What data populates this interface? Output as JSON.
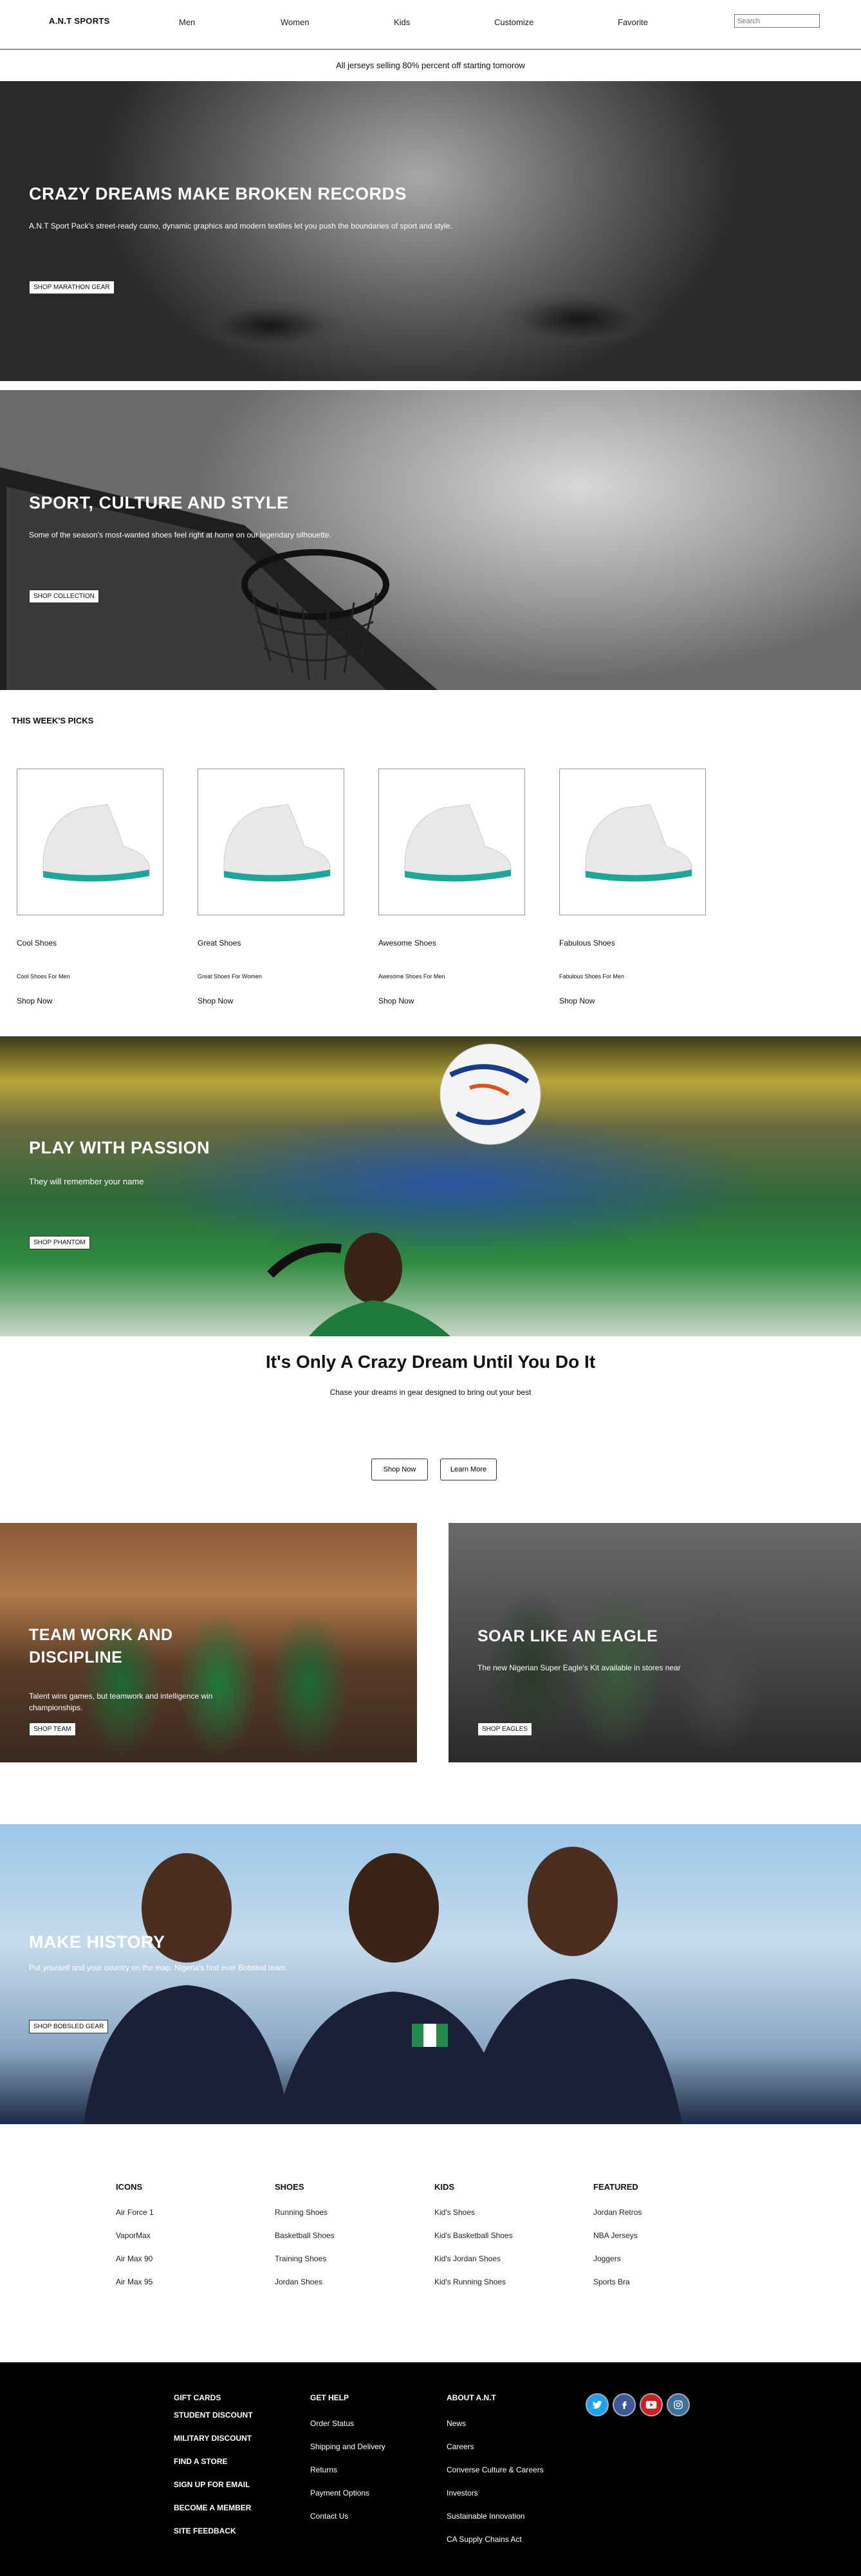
{
  "nav": {
    "brand": "A.N.T SPORTS",
    "links": [
      "Men",
      "Women",
      "Kids",
      "Customize",
      "Favorite"
    ],
    "search_placeholder": "Search"
  },
  "promo": "All jerseys selling 80% percent off starting tomorow",
  "hero1": {
    "title": "CRAZY DREAMS MAKE BROKEN RECORDS",
    "subtitle": "A.N.T Sport Pack's street-ready camo, dynamic graphics and modern textiles let you push the boundaries of sport and style.",
    "button": "SHOP MARATHON GEAR"
  },
  "hero2": {
    "title": "SPORT, CULTURE AND STYLE",
    "subtitle": "Some of the season's most-wanted shoes feel right at home on our legendary silhouette.",
    "button": "SHOP COLLECTION"
  },
  "picks": {
    "title": "THIS WEEK'S PICKS",
    "items": [
      {
        "name": "Cool Shoes",
        "sub": "Cool Shoes For Men",
        "shop": "Shop Now"
      },
      {
        "name": "Great Shoes",
        "sub": "Great Shoes For Women",
        "shop": "Shop Now"
      },
      {
        "name": "Awesome Shoes",
        "sub": "Awesome Shoes For Men",
        "shop": "Shop Now"
      },
      {
        "name": "Fabulous Shoes",
        "sub": "Fabulous Shoes For Men",
        "shop": "Shop Now"
      }
    ]
  },
  "hero3": {
    "title": "PLAY WITH PASSION",
    "subtitle": "They will remember your name",
    "button": "SHOP PHANTOM"
  },
  "dream": {
    "title": "It's Only A Crazy Dream Until You Do It",
    "subtitle": "Chase your dreams in gear designed to bring out your best",
    "shop": "Shop Now",
    "learn": "Learn More"
  },
  "split1": {
    "title_line1": "TEAM WORK AND",
    "title_line2": "DISCIPLINE",
    "subtitle_line1": "Talent wins games, but teamwork and intelligence win",
    "subtitle_line2": "championships.",
    "button": "SHOP TEAM"
  },
  "split2": {
    "title": "SOAR LIKE AN EAGLE",
    "subtitle": "The new Nigerian Super Eagle's Kit available in stores near",
    "button": "SHOP EAGLES"
  },
  "hero4": {
    "title": "MAKE HISTORY",
    "subtitle": "Put yourself and your country on the map. Nigeria's first ever Bobsled team.",
    "button": "SHOP BOBSLED GEAR"
  },
  "link_columns": [
    {
      "head": "ICONS",
      "links": [
        "Air Force 1",
        "VaporMax",
        "Air Max 90",
        "Air Max 95"
      ]
    },
    {
      "head": "SHOES",
      "links": [
        "Running Shoes",
        "Basketball Shoes",
        "Training Shoes",
        "Jordan Shoes"
      ]
    },
    {
      "head": "KIDS",
      "links": [
        "Kid's Shoes",
        "Kid's Basketball Shoes",
        "Kid's Jordan Shoes",
        "Kid's Running Shoes"
      ]
    },
    {
      "head": "FEATURED",
      "links": [
        "Jordan Retros",
        "NBA Jerseys",
        "Joggers",
        "Sports Bra"
      ]
    }
  ],
  "footer": {
    "bold_links": [
      "GIFT CARDS",
      "STUDENT DISCOUNT",
      "MILITARY DISCOUNT",
      "FIND A STORE",
      "SIGN UP FOR EMAIL",
      "BECOME A MEMBER",
      "SITE FEEDBACK"
    ],
    "get_help": {
      "head": "GET HELP",
      "links": [
        "Order Status",
        "Shipping and Delivery",
        "Returns",
        "Payment Options",
        "Contact Us"
      ]
    },
    "about": {
      "head": "ABOUT A.N.T",
      "links": [
        "News",
        "Careers",
        "Converse Culture & Careers",
        "Investors",
        "Sustainable Innovation",
        "CA Supply Chains Act"
      ]
    },
    "social": [
      {
        "icon": "twitter-icon",
        "color": "#1da1f2"
      },
      {
        "icon": "facebook-icon",
        "color": "#3b5998"
      },
      {
        "icon": "youtube-icon",
        "color": "#cd201f"
      },
      {
        "icon": "instagram-icon",
        "color": "#3f729b"
      }
    ]
  }
}
